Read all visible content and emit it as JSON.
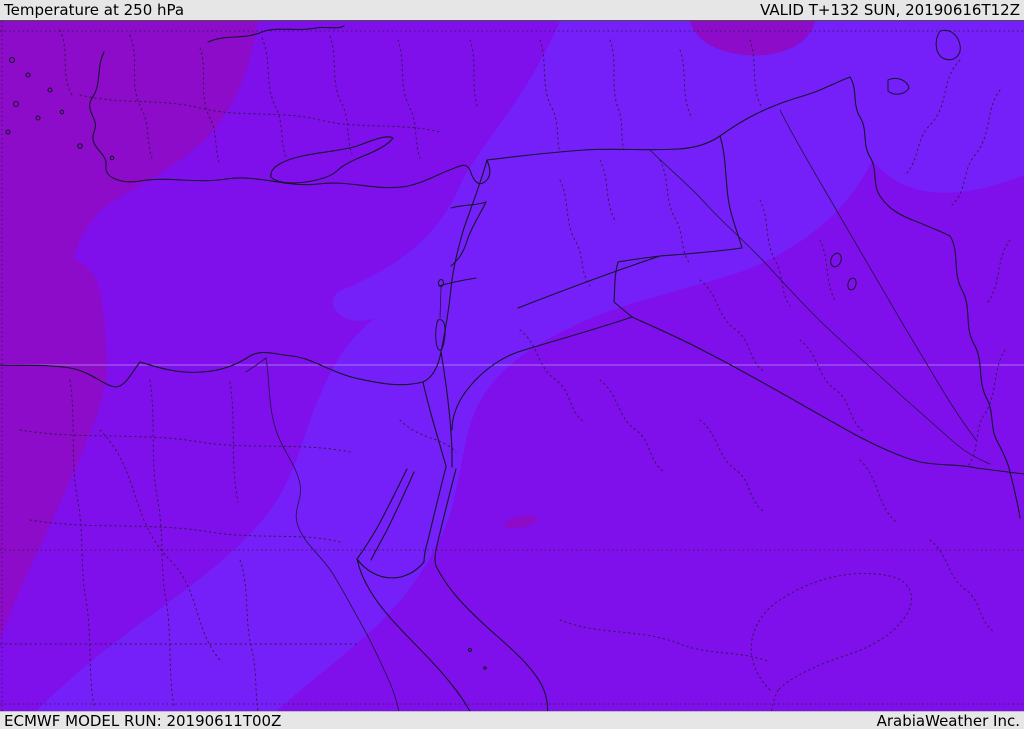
{
  "header": {
    "title": "Temperature at 250 hPa",
    "valid_label": "VALID T+132 SUN, 20190616T12Z"
  },
  "footer": {
    "model_run_label": "ECMWF MODEL RUN: 20190611T00Z",
    "brand_label": "ArabiaWeather Inc."
  },
  "map": {
    "type": "temperature-shaded-weather-map",
    "colors": {
      "shade_base": "#7f10ec",
      "shade_cold": "#8d0cc9",
      "shade_cool": "#7520f9",
      "border_line": "#16142e",
      "admin_line": "#2a1838",
      "graticule_light": "#c9c2f0",
      "bar_bg": "#e6e6e6",
      "bar_text": "#000000"
    }
  }
}
